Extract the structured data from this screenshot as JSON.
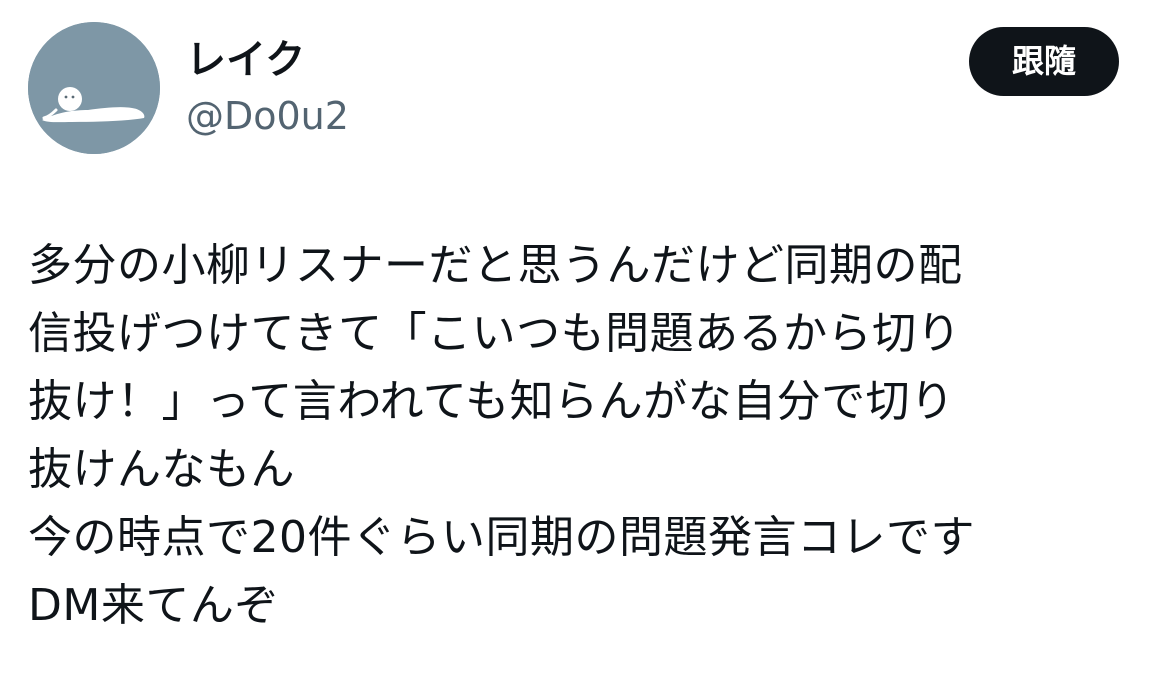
{
  "user": {
    "display_name": "レイク",
    "handle": "@Do0u2",
    "avatar_icon": "lying-figure-avatar"
  },
  "follow_button": {
    "label": "跟隨"
  },
  "tweet": {
    "lines": [
      "多分の小柳リスナーだと思うんだけど同期の配",
      "信投げつけてきて「こいつも問題あるから切り",
      "抜け！」って言われても知らんがな自分で切り",
      "抜けんなもん",
      "今の時点で20件ぐらい同期の問題発言コレです",
      "DM来てんぞ"
    ]
  },
  "colors": {
    "avatar_bg": "#7e97a6",
    "button_bg": "#0f1419",
    "handle": "#536471",
    "text": "#0f1419"
  }
}
